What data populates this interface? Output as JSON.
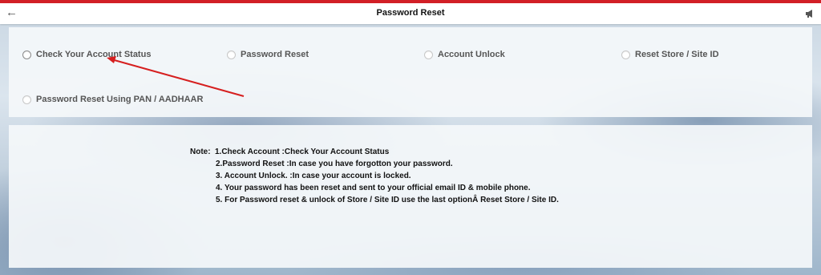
{
  "header": {
    "title": "Password Reset"
  },
  "options": [
    {
      "label": "Check Your Account Status"
    },
    {
      "label": "Password Reset"
    },
    {
      "label": "Account Unlock"
    },
    {
      "label": "Reset Store / Site ID"
    },
    {
      "label": "Password Reset Using PAN / AADHAAR"
    }
  ],
  "note": {
    "label": "Note:",
    "lines": [
      "1.Check Account :Check Your Account Status",
      "2.Password Reset :In case you have forgotton your password.",
      "3. Account Unlock. :In case your account is locked.",
      "4. Your password has been reset and sent to your official email ID & mobile phone.",
      "5. For Password reset & unlock of Store / Site ID use the last optionÂ Reset Store / Site ID."
    ]
  },
  "colors": {
    "accent_bar": "#d21f26",
    "annotation_arrow": "#d61f1f"
  },
  "icons": {
    "back": "back-arrow-icon",
    "announce": "megaphone-icon"
  }
}
